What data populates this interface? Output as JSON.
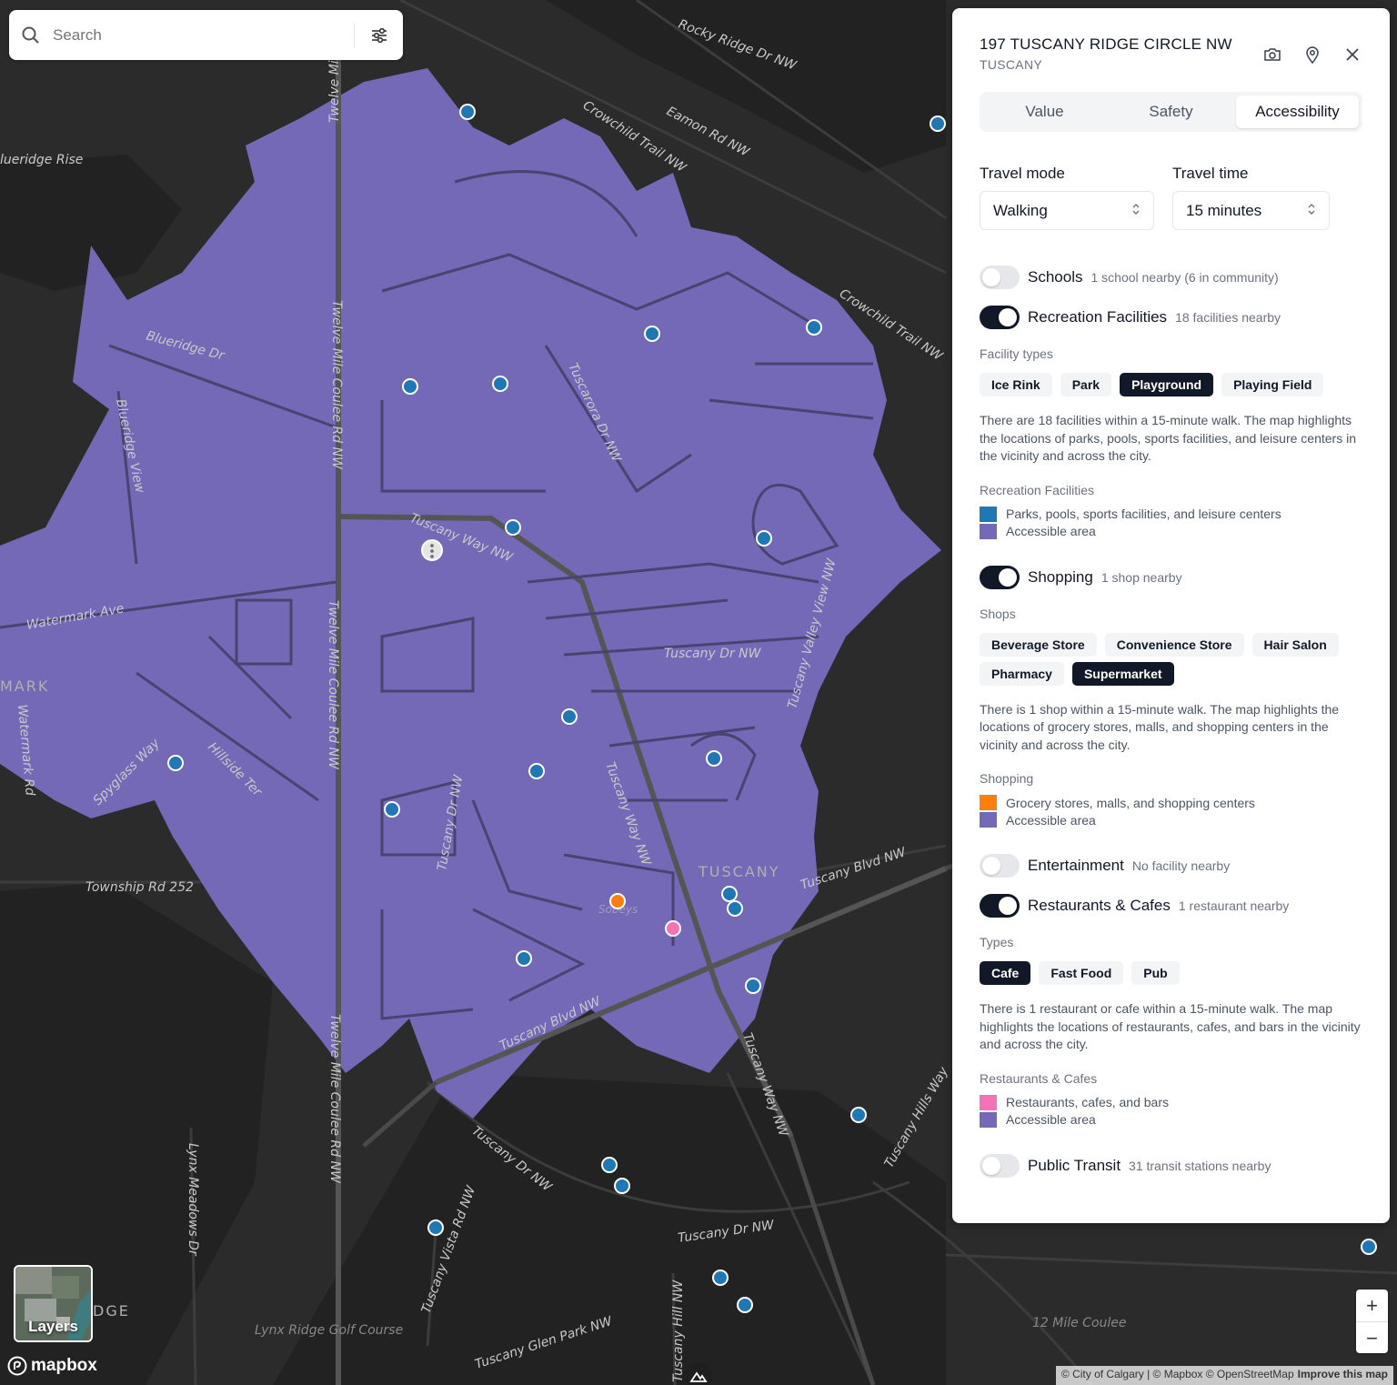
{
  "search": {
    "placeholder": "Search"
  },
  "panel": {
    "address": "197 TUSCANY RIDGE CIRCLE NW",
    "community": "TUSCANY",
    "tabs": [
      {
        "label": "Value",
        "active": false
      },
      {
        "label": "Safety",
        "active": false
      },
      {
        "label": "Accessibility",
        "active": true
      }
    ],
    "travel_mode": {
      "label": "Travel mode",
      "value": "Walking"
    },
    "travel_time": {
      "label": "Travel time",
      "value": "15 minutes"
    },
    "schools": {
      "label": "Schools",
      "sub": "1 school nearby (6 in community)",
      "on": false
    },
    "recreation": {
      "label": "Recreation Facilities",
      "sub": "18 facilities nearby",
      "on": true,
      "types_label": "Facility types",
      "chips": [
        {
          "label": "Ice Rink",
          "on": false
        },
        {
          "label": "Park",
          "on": false
        },
        {
          "label": "Playground",
          "on": true
        },
        {
          "label": "Playing Field",
          "on": false
        }
      ],
      "desc": "There are 18 facilities within a 15-minute walk. The map highlights the locations of parks, pools, sports facilities, and leisure centers in the vicinity and across the city.",
      "legend_title": "Recreation Facilities",
      "legend": [
        {
          "label": "Parks, pools, sports facilities, and leisure centers",
          "color": "#1f77b4"
        },
        {
          "label": "Accessible area",
          "color": "#7469b6"
        }
      ]
    },
    "shopping": {
      "label": "Shopping",
      "sub": "1 shop nearby",
      "on": true,
      "types_label": "Shops",
      "chips": [
        {
          "label": "Beverage Store",
          "on": false
        },
        {
          "label": "Convenience Store",
          "on": false
        },
        {
          "label": "Hair Salon",
          "on": false
        },
        {
          "label": "Pharmacy",
          "on": false
        },
        {
          "label": "Supermarket",
          "on": true
        }
      ],
      "desc": "There is 1 shop within a 15-minute walk. The map highlights the locations of grocery stores, malls, and shopping centers in the vicinity and across the city.",
      "legend_title": "Shopping",
      "legend": [
        {
          "label": "Grocery stores, malls, and shopping centers",
          "color": "#ff7f0e"
        },
        {
          "label": "Accessible area",
          "color": "#7469b6"
        }
      ]
    },
    "entertainment": {
      "label": "Entertainment",
      "sub": "No facility nearby",
      "on": false
    },
    "restaurants": {
      "label": "Restaurants & Cafes",
      "sub": "1 restaurant nearby",
      "on": true,
      "types_label": "Types",
      "chips": [
        {
          "label": "Cafe",
          "on": true
        },
        {
          "label": "Fast Food",
          "on": false
        },
        {
          "label": "Pub",
          "on": false
        }
      ],
      "desc": "There is 1 restaurant or cafe within a 15-minute walk. The map highlights the locations of restaurants, cafes, and bars in the vicinity and across the city.",
      "legend_title": "Restaurants & Cafes",
      "legend": [
        {
          "label": "Restaurants, cafes, and bars",
          "color": "#f472b6"
        },
        {
          "label": "Accessible area",
          "color": "#7469b6"
        }
      ]
    },
    "transit": {
      "label": "Public Transit",
      "sub": "31 transit stations nearby",
      "on": false
    }
  },
  "map": {
    "colors": {
      "background": "#2b2b2b",
      "accessible_area": "#7469b6",
      "recreation": "#1f77b4",
      "shopping": "#ff7f0e",
      "restaurant": "#f472b6"
    },
    "labels": {
      "rocky_ridge": "Rocky Ridge Dr NW",
      "eamon": "Eamon Rd NW",
      "crowchild1": "Crowchild Trail NW",
      "crowchild2": "Crowchild Trail NW",
      "blueridge_rise": "lueridge Rise",
      "twelve_top": "Twelve Mi",
      "blueridge_dr": "Blueridge Dr",
      "blueridge_view": "Blueridge View",
      "twelve_mile1": "Twelve Mile Coulee Rd NW",
      "twelve_mile2": "Twelve Mile Coulee Rd NW",
      "twelve_mile3": "Twelve Mile Coulee Rd NW",
      "tuscarora": "Tuscarora Dr NW",
      "tuscany_way1": "Tuscany Way NW",
      "tuscany_way2": "Tuscany Way NW",
      "tuscany_way3": "Tuscany Way NW",
      "watermark_ave": "Watermark Ave",
      "mark": "MARK",
      "watermark_rd": "Watermark Rd",
      "tuscany_dr1": "Tuscany Dr NW",
      "tuscany_dr2": "Tuscany Dr NW",
      "tuscany_dr3": "Tuscany Dr NW",
      "tuscany_dr4": "Tuscany Dr NW",
      "tuscany_valley": "Tuscany Valley View NW",
      "spyglass": "Spyglass Way",
      "hillside": "Hillside Ter",
      "township": "Township Rd 252",
      "tuscany_caps": "TUSCANY",
      "tuscany_blvd1": "Tuscany Blvd NW",
      "tuscany_blvd2": "Tuscany Blvd NW",
      "sobeys": "Sobeys",
      "lynx_meadows": "Lynx Meadows Dr",
      "tuscany_vista": "Tuscany Vista Rd NW",
      "tuscany_hills": "Tuscany Hills Way",
      "tuscany_glen": "Tuscany Glen Park NW",
      "tuscany_hill": "Tuscany Hill NW",
      "lynx_golf": "Lynx Ridge Golf Course",
      "twelve_coulee": "12 Mile Coulee",
      "dge": "DGE"
    }
  },
  "layers": {
    "label": "Layers"
  },
  "mapbox": {
    "brand": "mapbox"
  },
  "attribution": {
    "text": "© City of Calgary | © Mapbox © OpenStreetMap",
    "link": "Improve this map"
  },
  "zoom": {
    "in": "+",
    "out": "−"
  }
}
